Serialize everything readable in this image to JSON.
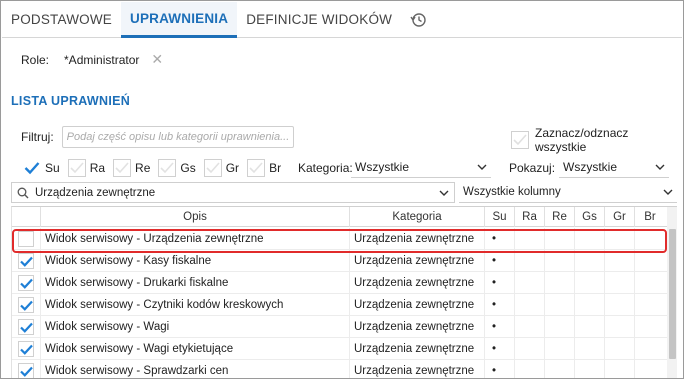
{
  "tabs": [
    {
      "label": "PODSTAWOWE",
      "active": false
    },
    {
      "label": "UPRAWNIENIA",
      "active": true
    },
    {
      "label": "DEFINICJE WIDOKÓW",
      "active": false
    }
  ],
  "tab_icon": "history-icon",
  "role": {
    "label": "Role:",
    "value": "*Administrator",
    "clear_icon": "close-icon"
  },
  "section_title": "LISTA UPRAWNIEŃ",
  "filter": {
    "label": "Filtruj:",
    "placeholder": "Podaj część opisu lub kategorii uprawnienia..."
  },
  "select_all": {
    "label": "Zaznacz/odznacz wszystkie",
    "checked": false
  },
  "flags": [
    {
      "label": "Su",
      "checked": true
    },
    {
      "label": "Ra",
      "checked": false
    },
    {
      "label": "Re",
      "checked": false
    },
    {
      "label": "Gs",
      "checked": false
    },
    {
      "label": "Gr",
      "checked": false
    },
    {
      "label": "Br",
      "checked": false
    }
  ],
  "category": {
    "label": "Kategoria:",
    "value": "Wszystkie"
  },
  "show": {
    "label": "Pokazuj:",
    "value": "Wszystkie"
  },
  "search": {
    "value": "Urządzenia zewnętrzne"
  },
  "columns_select": {
    "value": "Wszystkie kolumny"
  },
  "table": {
    "headers": [
      "",
      "Opis",
      "Kategoria",
      "Su",
      "Ra",
      "Re",
      "Gs",
      "Gr",
      "Br"
    ],
    "rows": [
      {
        "checked": false,
        "opis": "Widok serwisowy - Urządzenia zewnętrzne",
        "kategoria": "Urządzenia zewnętrzne",
        "su": "•"
      },
      {
        "checked": true,
        "opis": "Widok serwisowy - Kasy fiskalne",
        "kategoria": "Urządzenia zewnętrzne",
        "su": "•"
      },
      {
        "checked": true,
        "opis": "Widok serwisowy - Drukarki fiskalne",
        "kategoria": "Urządzenia zewnętrzne",
        "su": "•"
      },
      {
        "checked": true,
        "opis": "Widok serwisowy - Czytniki kodów kreskowych",
        "kategoria": "Urządzenia zewnętrzne",
        "su": "•"
      },
      {
        "checked": true,
        "opis": "Widok serwisowy - Wagi",
        "kategoria": "Urządzenia zewnętrzne",
        "su": "•"
      },
      {
        "checked": true,
        "opis": "Widok serwisowy - Wagi etykietujące",
        "kategoria": "Urządzenia zewnętrzne",
        "su": "•"
      },
      {
        "checked": true,
        "opis": "Widok serwisowy - Sprawdzarki cen",
        "kategoria": "Urządzenia zewnętrzne",
        "su": "•"
      }
    ]
  },
  "colors": {
    "accent": "#1d6fb8",
    "check": "#1e7fd6",
    "highlight": "#e12b2b"
  }
}
